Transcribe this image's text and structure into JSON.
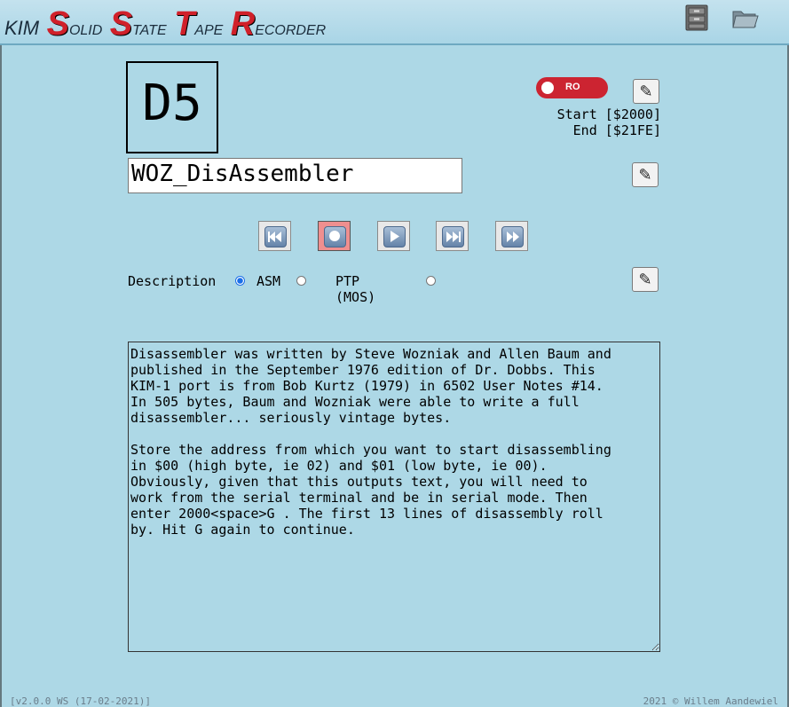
{
  "header": {
    "logo": {
      "kim": "KIM",
      "words": [
        {
          "cap": "S",
          "rest": "OLID"
        },
        {
          "cap": "S",
          "rest": "TATE"
        },
        {
          "cap": "T",
          "rest": "APE"
        },
        {
          "cap": "R",
          "rest": "ECORDER"
        }
      ]
    },
    "icons": [
      "file-cabinet-icon",
      "open-folder-icon"
    ]
  },
  "tape": {
    "id": "D5",
    "ro_label": "RO",
    "start": "Start [$2000]",
    "end": "End [$21FE]",
    "name": "WOZ_DisAssembler"
  },
  "controls": [
    "rewind",
    "record",
    "play",
    "skip-forward",
    "fast-forward"
  ],
  "description": {
    "label": "Description",
    "format_options": [
      {
        "label": "ASM",
        "checked": true
      },
      {
        "label": "PTP (MOS)",
        "checked": false
      }
    ],
    "text": "Disassembler was written by Steve Wozniak and Allen Baum and\npublished in the September 1976 edition of Dr. Dobbs. This\nKIM-1 port is from Bob Kurtz (1979) in 6502 User Notes #14.\nIn 505 bytes, Baum and Wozniak were able to write a full\ndisassembler... seriously vintage bytes.\n\nStore the address from which you want to start disassembling\nin $00 (high byte, ie 02) and $01 (low byte, ie 00).\nObviously, given that this outputs text, you will need to\nwork from the serial terminal and be in serial mode. Then\nenter 2000<space>G . The first 13 lines of disassembly roll\nby. Hit G again to continue."
  },
  "footer": {
    "version": "[v2.0.0 WS (17-02-2021)]",
    "copyright": "2021 © Willem Aandewiel"
  },
  "colors": {
    "background": "#add8e6",
    "logo_red": "#d0202a",
    "ro_red": "#cc2431",
    "record_bg": "#ef8f8f"
  }
}
